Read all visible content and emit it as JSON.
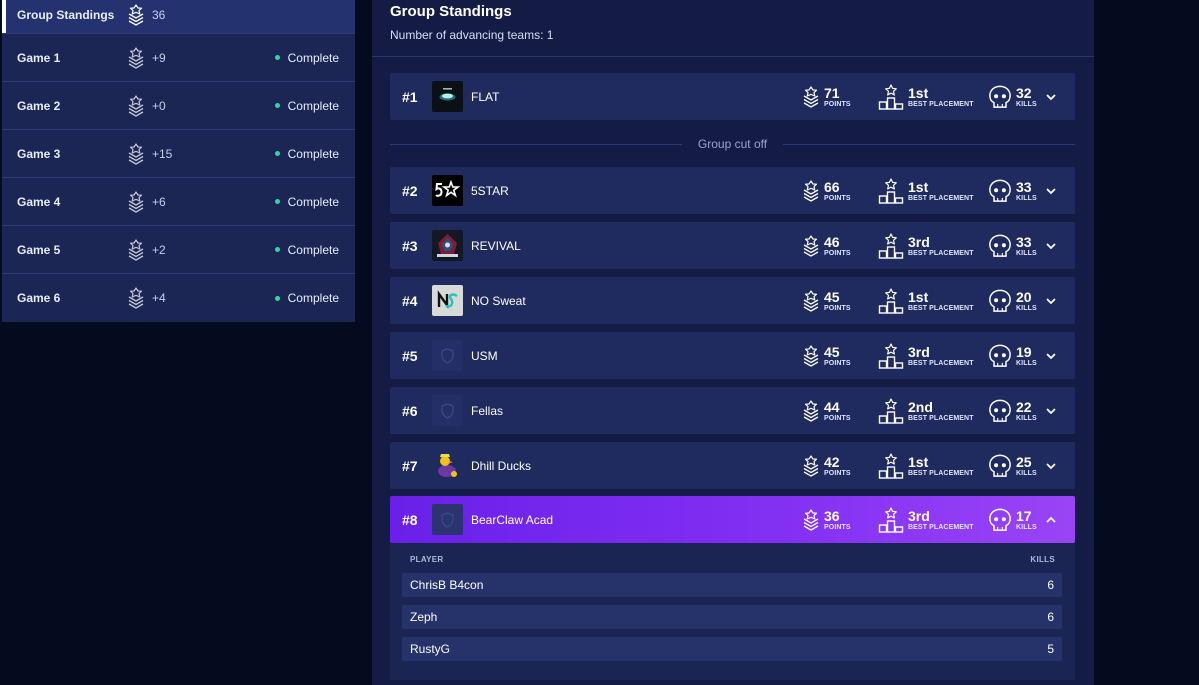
{
  "sidebar": {
    "items": [
      {
        "name": "Group Standings",
        "points": "36",
        "status": ""
      },
      {
        "name": "Game 1",
        "points": "+9",
        "status": "Complete"
      },
      {
        "name": "Game 2",
        "points": "+0",
        "status": "Complete"
      },
      {
        "name": "Game 3",
        "points": "+15",
        "status": "Complete"
      },
      {
        "name": "Game 4",
        "points": "+6",
        "status": "Complete"
      },
      {
        "name": "Game 5",
        "points": "+2",
        "status": "Complete"
      },
      {
        "name": "Game 6",
        "points": "+4",
        "status": "Complete"
      }
    ]
  },
  "main": {
    "title": "Group Standings",
    "subtitle": "Number of advancing teams: 1",
    "cutoff_label": "Group cut off",
    "labels": {
      "points": "POINTS",
      "best_placement": "BEST PLACEMENT",
      "kills": "KILLS"
    },
    "teams": [
      {
        "rank": "#1",
        "name": "FLAT",
        "points": "71",
        "placement": "1st",
        "kills": "32"
      },
      {
        "rank": "#2",
        "name": "5STAR",
        "points": "66",
        "placement": "1st",
        "kills": "33"
      },
      {
        "rank": "#3",
        "name": "REVIVAL",
        "points": "46",
        "placement": "3rd",
        "kills": "33"
      },
      {
        "rank": "#4",
        "name": "NO Sweat",
        "points": "45",
        "placement": "1st",
        "kills": "20"
      },
      {
        "rank": "#5",
        "name": "USM",
        "points": "45",
        "placement": "3rd",
        "kills": "19"
      },
      {
        "rank": "#6",
        "name": "Fellas",
        "points": "44",
        "placement": "2nd",
        "kills": "22"
      },
      {
        "rank": "#7",
        "name": "Dhill Ducks",
        "points": "42",
        "placement": "1st",
        "kills": "25"
      },
      {
        "rank": "#8",
        "name": "BearClaw Acad",
        "points": "36",
        "placement": "3rd",
        "kills": "17"
      }
    ],
    "player_table": {
      "header_player": "PLAYER",
      "header_kills": "KILLS",
      "players": [
        {
          "name": "ChrisB B4con",
          "kills": "6"
        },
        {
          "name": "Zeph",
          "kills": "6"
        },
        {
          "name": "RustyG",
          "kills": "5"
        }
      ]
    }
  },
  "colors": {
    "background": "#050b1f",
    "panel": "#141c45",
    "row": "#1f2a5e",
    "highlight": "#7c2cf0",
    "status_dot": "#2fd99a"
  },
  "icons": {
    "points": "points-badge-icon",
    "placement": "podium-star-icon",
    "kills": "skull-icon",
    "expand": "chevron-down-icon",
    "collapse": "chevron-up-icon"
  }
}
